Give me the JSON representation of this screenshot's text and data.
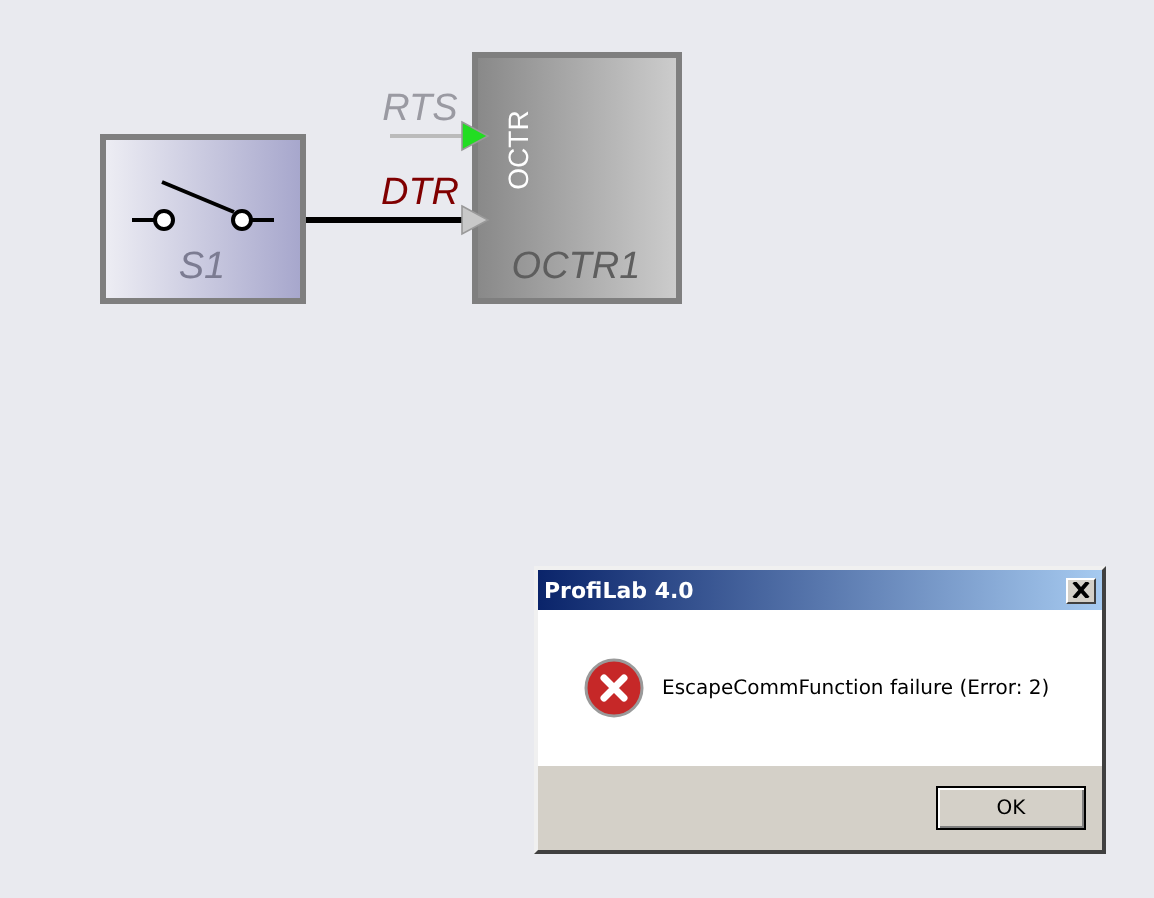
{
  "diagram": {
    "blocks": [
      {
        "kind": "switch",
        "name": "S1",
        "closed": false
      },
      {
        "kind": "device",
        "name": "OCTR1",
        "type_label": "OCTR",
        "pins": [
          {
            "label": "RTS",
            "active": false,
            "color": "#22dd22"
          },
          {
            "label": "DTR",
            "active": true,
            "color": "#c8c8c8"
          }
        ]
      }
    ]
  },
  "dialog": {
    "title": "ProfiLab 4.0",
    "message": "EscapeCommFunction failure (Error: 2)",
    "buttons": [
      "OK"
    ]
  }
}
